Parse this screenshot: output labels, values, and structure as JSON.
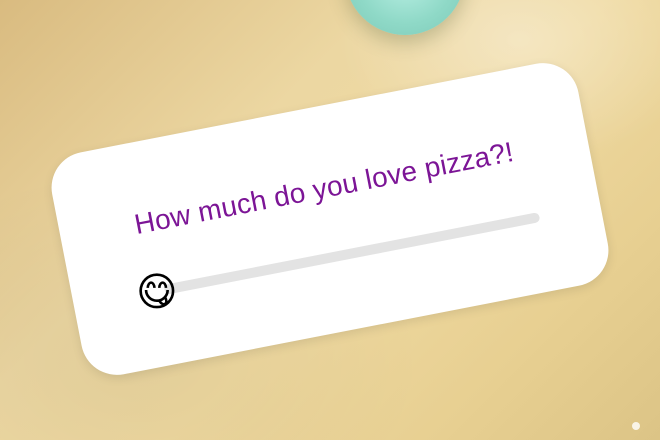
{
  "poll": {
    "question": "How much do you love pizza?!",
    "slider_emoji": "😋",
    "value_fraction": 0.0
  },
  "colors": {
    "question_text": "#7c1596",
    "track": "#e3e3e3",
    "card": "#ffffff"
  }
}
